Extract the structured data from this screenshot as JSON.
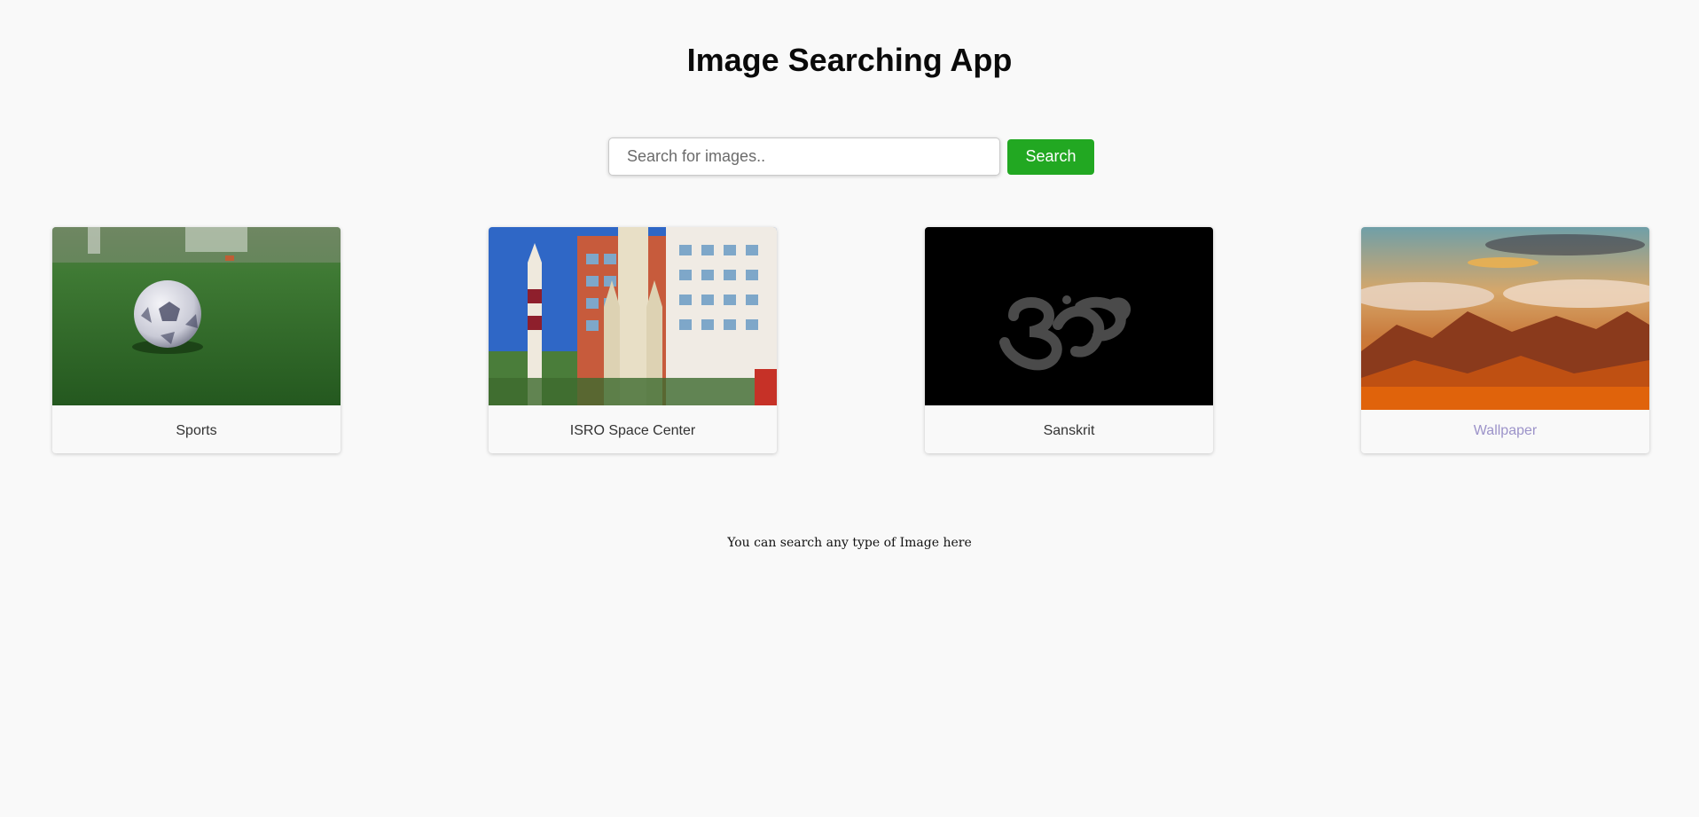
{
  "app": {
    "title": "Image Searching App"
  },
  "search": {
    "placeholder": "Search for images..",
    "value": "",
    "button_label": "Search"
  },
  "results": [
    {
      "caption": "Sports",
      "image": "soccer-ball-on-grass",
      "visited": false
    },
    {
      "caption": "ISRO Space Center",
      "image": "rockets-and-building",
      "visited": false
    },
    {
      "caption": "Sanskrit",
      "image": "om-symbol-on-black",
      "visited": false
    },
    {
      "caption": "Wallpaper",
      "image": "mountains-at-sunset",
      "visited": true
    }
  ],
  "footer": {
    "note": "You can search any type of Image here"
  },
  "colors": {
    "background": "#f9f9f9",
    "search_button": "#22a822",
    "visited_link": "#9c93c9"
  }
}
